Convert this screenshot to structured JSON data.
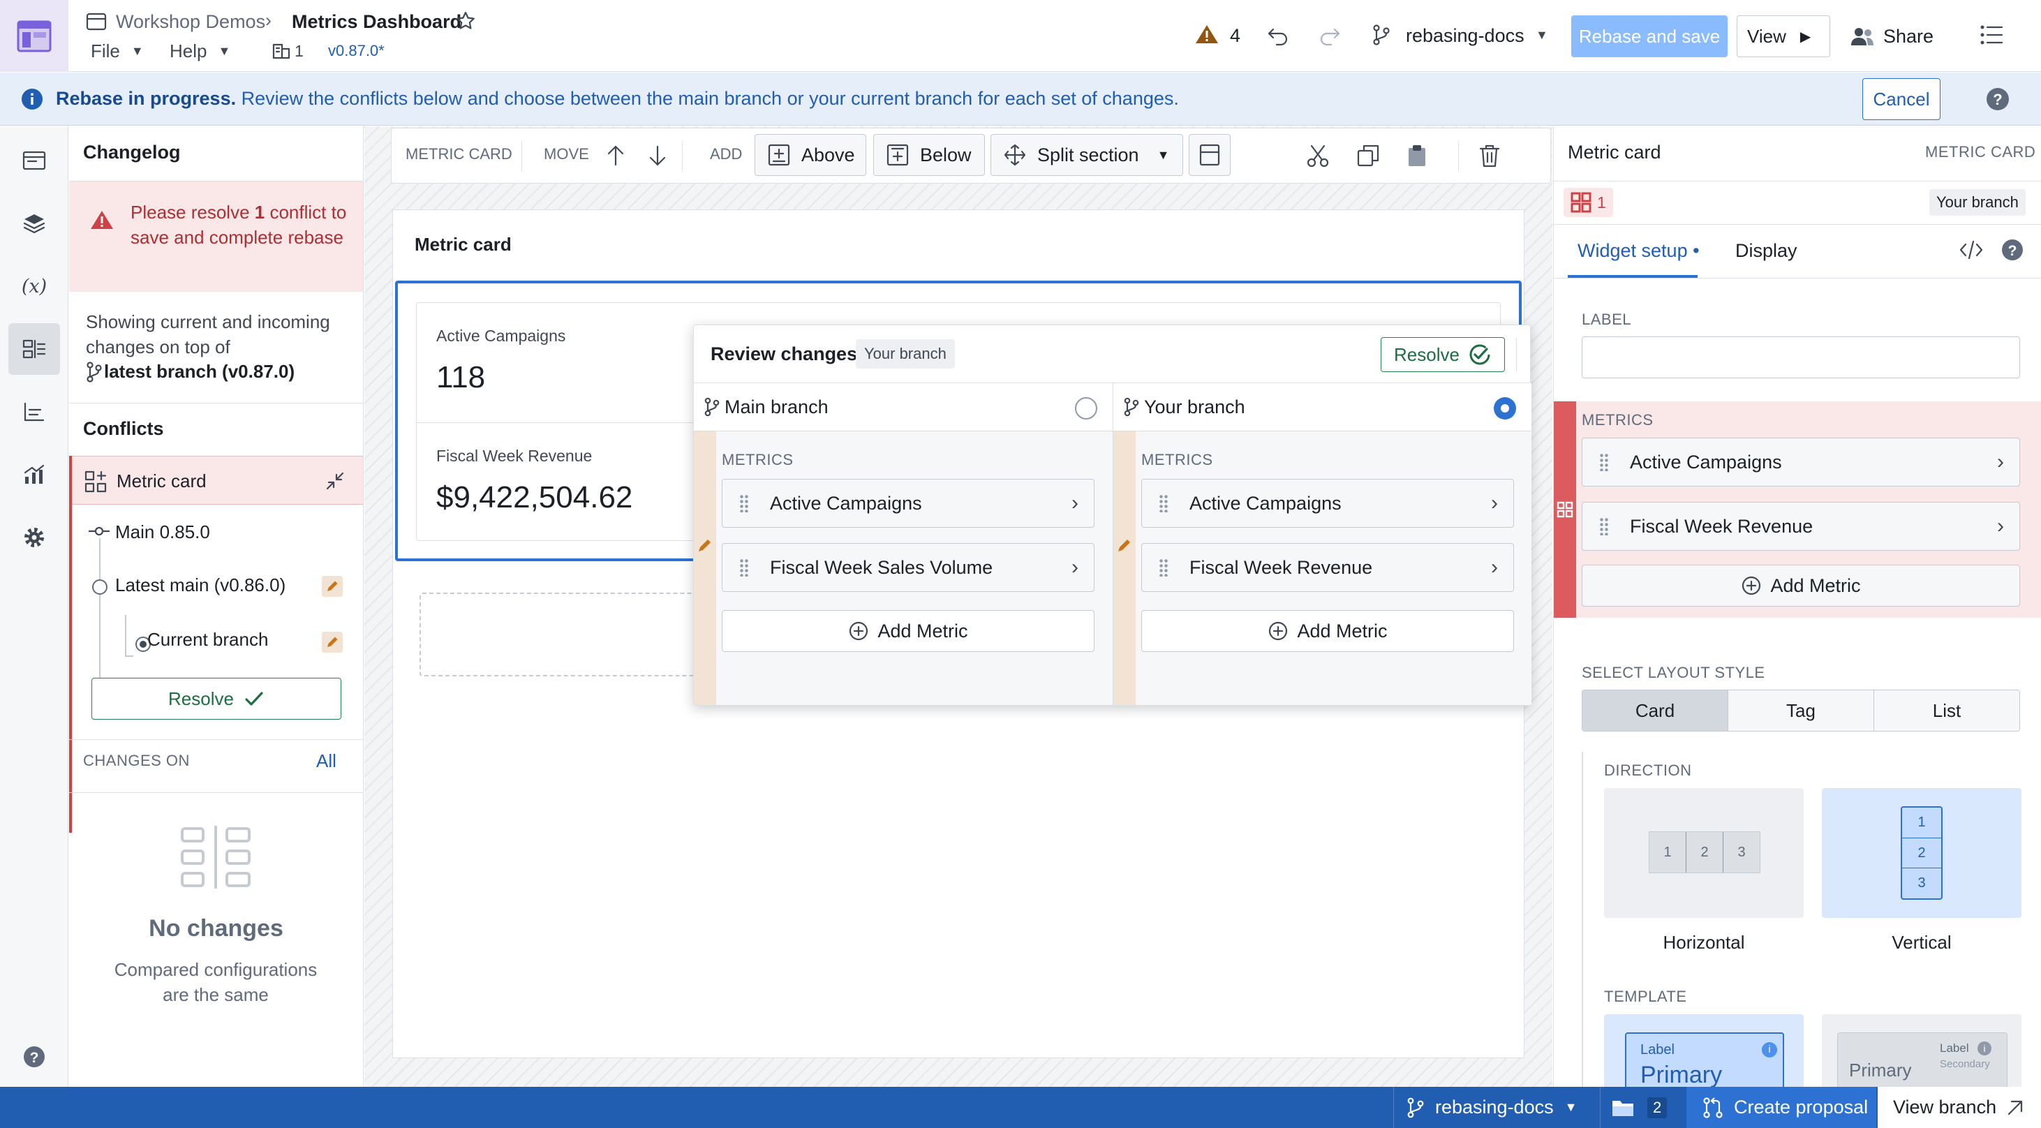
{
  "header": {
    "breadcrumb_parent": "Workshop Demos",
    "title": "Metrics Dashboard",
    "menus": [
      "File",
      "Help"
    ],
    "dependency_count": "1",
    "version": "v0.87.0*",
    "warning_count": "4",
    "branch": "rebasing-docs",
    "rebase_save_label": "Rebase and save",
    "view_label": "View",
    "share_label": "Share"
  },
  "banner": {
    "bold": "Rebase in progress.",
    "text": " Review the conflicts below and choose between the main branch or your current branch for each set of changes.",
    "cancel_label": "Cancel"
  },
  "changelog": {
    "title": "Changelog",
    "error_pre": "Please resolve ",
    "error_count": "1",
    "error_post": " conflict to save and complete rebase",
    "info_text": "Showing current and incoming changes on top of",
    "info_branch": "latest branch (v0.87.0)",
    "conflicts_title": "Conflicts",
    "conflict_item": "Metric card",
    "tree": [
      {
        "label": "Main 0.85.0"
      },
      {
        "label": "Latest main (v0.86.0)"
      },
      {
        "label": "Current branch"
      }
    ],
    "resolve_label": "Resolve",
    "changes_on_label": "CHANGES ON",
    "changes_on_value": "All",
    "empty_title": "No changes",
    "empty_text": "Compared configurations are the same"
  },
  "toolbar": {
    "metric_card_label": "METRIC CARD",
    "move_label": "MOVE",
    "add_label": "ADD",
    "above_label": "Above",
    "below_label": "Below",
    "split_label": "Split section"
  },
  "canvas": {
    "section_title": "Metric card",
    "metrics": [
      {
        "label": "Active Campaigns",
        "value": "118"
      },
      {
        "label": "Fiscal Week Revenue",
        "value": "$9,422,504.62"
      }
    ]
  },
  "review": {
    "title": "Review changes",
    "tag": "Your branch",
    "resolve_label": "Resolve",
    "main": {
      "label": "Main branch",
      "section": "METRICS",
      "items": [
        "Active Campaigns",
        "Fiscal Week Sales Volume"
      ],
      "add_label": "Add Metric"
    },
    "yours": {
      "label": "Your branch",
      "section": "METRICS",
      "items": [
        "Active Campaigns",
        "Fiscal Week Revenue"
      ],
      "add_label": "Add Metric"
    }
  },
  "rpanel": {
    "title": "Metric card",
    "type_label": "METRIC CARD",
    "conflict_count": "1",
    "branch_tag": "Your branch",
    "tabs": [
      "Widget setup",
      "Display"
    ],
    "label_heading": "LABEL",
    "label_value": "",
    "metrics_heading": "METRICS",
    "metrics": [
      "Active Campaigns",
      "Fiscal Week Revenue"
    ],
    "add_metric_label": "Add Metric",
    "layout_heading": "SELECT LAYOUT STYLE",
    "layout_options": [
      "Card",
      "Tag",
      "List"
    ],
    "direction_heading": "DIRECTION",
    "direction_options": [
      "Horizontal",
      "Vertical"
    ],
    "template_heading": "TEMPLATE",
    "template_a": {
      "label": "Label",
      "primary": "Primary"
    },
    "template_b": {
      "label": "Label",
      "primary": "Primary",
      "secondary": "Secondary"
    }
  },
  "status": {
    "branch": "rebasing-docs",
    "folder_count": "2",
    "create_proposal": "Create proposal",
    "view_branch": "View branch"
  },
  "colors": {
    "accent": "#2d72d2",
    "banner_bg": "#e5eef9",
    "error_bg": "#fae8e8",
    "status_bar": "#215db0"
  }
}
